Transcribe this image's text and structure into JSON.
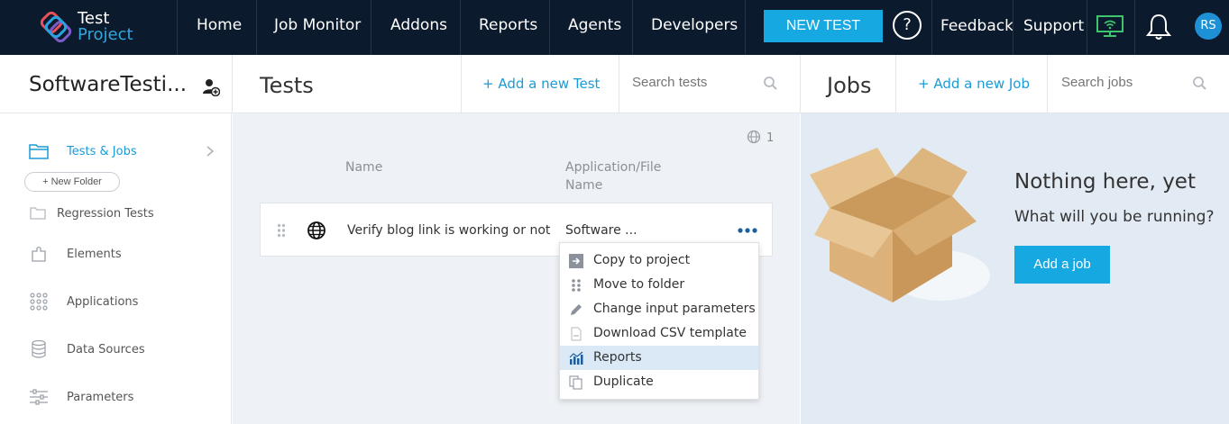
{
  "nav": {
    "logo_line1": "Test",
    "logo_line2": "Project",
    "items": [
      "Home",
      "Job Monitor",
      "Addons",
      "Reports",
      "Agents",
      "Developers"
    ],
    "new_test": "NEW TEST",
    "help": "?",
    "feedback": "Feedback",
    "support": "Support",
    "avatar_initials": "RS",
    "colors": {
      "bg": "#0b1a2c",
      "accent": "#16a9e1",
      "logo_blue": "#33a6dc"
    }
  },
  "header": {
    "project_name": "SoftwareTesti...",
    "tests_title": "Tests",
    "add_test": "+ Add a new Test",
    "search_tests_placeholder": "Search tests",
    "jobs_title": "Jobs",
    "add_job": "+ Add a new Job",
    "search_jobs_placeholder": "Search jobs"
  },
  "sidebar": {
    "tests_jobs": "Tests & Jobs",
    "new_folder": "+ New Folder",
    "regression": "Regression Tests",
    "elements": "Elements",
    "applications": "Applications",
    "data_sources": "Data Sources",
    "parameters": "Parameters"
  },
  "tests": {
    "globe_count": "1",
    "col_name": "Name",
    "col_app_line1": "Application/File",
    "col_app_line2": "Name",
    "row": {
      "name": "Verify blog link is working or not",
      "app": "Software ..."
    },
    "menu": [
      {
        "label": "Copy to project",
        "icon": "copy-to-project-icon"
      },
      {
        "label": "Move to folder",
        "icon": "move-icon"
      },
      {
        "label": "Change input parameters",
        "icon": "pencil-icon"
      },
      {
        "label": "Download CSV template",
        "icon": "csv-file-icon"
      },
      {
        "label": "Reports",
        "icon": "reports-chart-icon"
      },
      {
        "label": "Duplicate",
        "icon": "duplicate-icon"
      }
    ],
    "highlighted_menu_item": "Reports"
  },
  "jobs": {
    "empty_title": "Nothing here, yet",
    "empty_sub": "What will you be running?",
    "add_job_button": "Add a job"
  }
}
